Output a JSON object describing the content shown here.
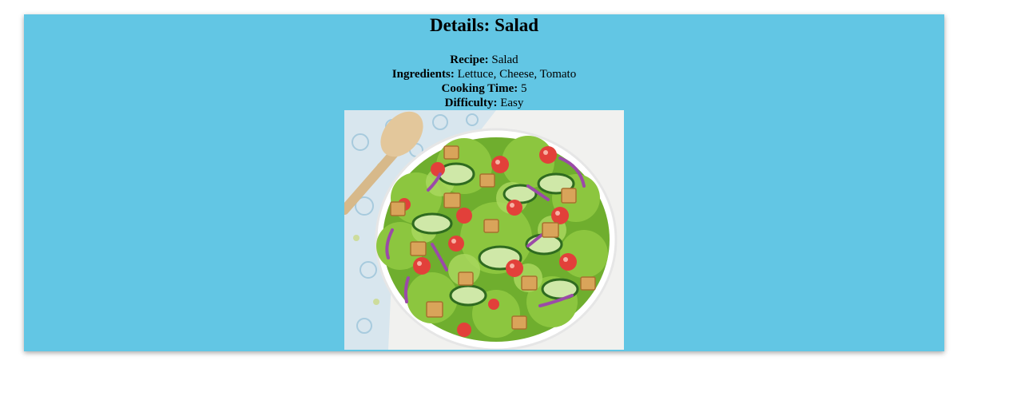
{
  "details": {
    "title": "Details: Salad",
    "rows": [
      {
        "label": "Recipe:",
        "value": "Salad"
      },
      {
        "label": "Ingredients:",
        "value": "Lettuce, Cheese, Tomato"
      },
      {
        "label": "Cooking Time:",
        "value": "5"
      },
      {
        "label": "Difficulty:",
        "value": "Easy"
      }
    ]
  },
  "image": {
    "subject": "salad-bowl"
  }
}
